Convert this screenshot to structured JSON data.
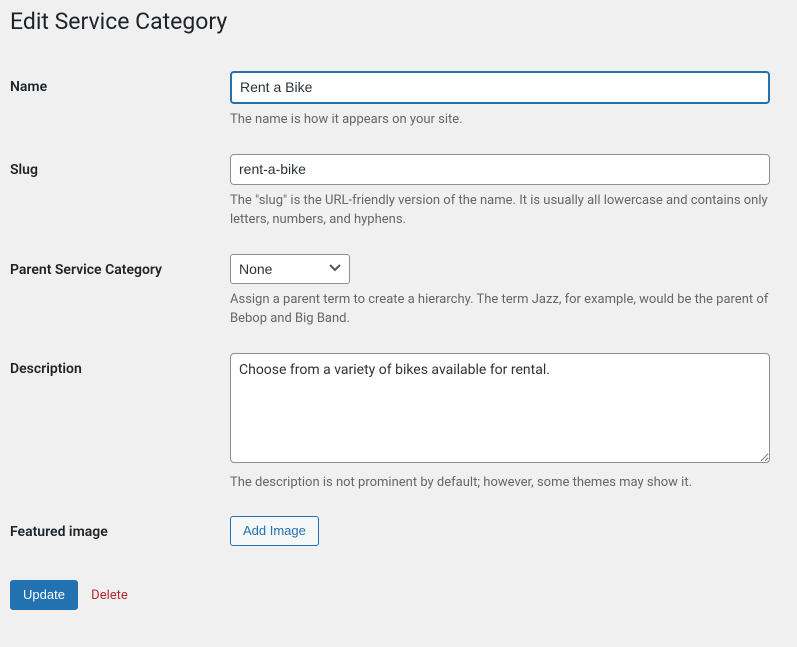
{
  "page": {
    "title": "Edit Service Category"
  },
  "fields": {
    "name": {
      "label": "Name",
      "value": "Rent a Bike",
      "help": "The name is how it appears on your site."
    },
    "slug": {
      "label": "Slug",
      "value": "rent-a-bike",
      "help": "The \"slug\" is the URL-friendly version of the name. It is usually all lowercase and contains only letters, numbers, and hyphens."
    },
    "parent": {
      "label": "Parent Service Category",
      "selected": "None",
      "help": "Assign a parent term to create a hierarchy. The term Jazz, for example, would be the parent of Bebop and Big Band."
    },
    "description": {
      "label": "Description",
      "value": "Choose from a variety of bikes available for rental.",
      "help": "The description is not prominent by default; however, some themes may show it."
    },
    "featured_image": {
      "label": "Featured image",
      "button": "Add Image"
    }
  },
  "actions": {
    "update": "Update",
    "delete": "Delete"
  }
}
